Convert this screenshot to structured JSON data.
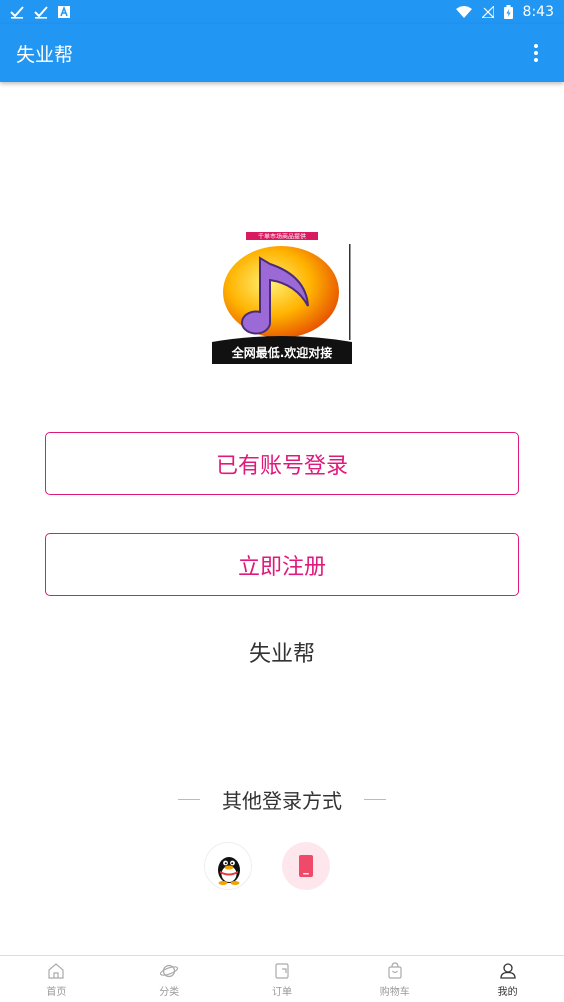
{
  "status_bar": {
    "time": "8:43"
  },
  "app_bar": {
    "title": "失业帮"
  },
  "logo": {
    "top_text": "千单市场商品提供",
    "bottom_text": "全网最低.欢迎对接"
  },
  "buttons": {
    "login": "已有账号登录",
    "register": "立即注册"
  },
  "app_name": "失业帮",
  "other_login": {
    "title": "其他登录方式"
  },
  "bottom_nav": {
    "items": [
      {
        "label": "首页",
        "icon": "home-icon"
      },
      {
        "label": "分类",
        "icon": "planet-icon"
      },
      {
        "label": "订单",
        "icon": "order-icon"
      },
      {
        "label": "购物车",
        "icon": "cart-icon"
      },
      {
        "label": "我的",
        "icon": "user-icon",
        "active": true
      }
    ]
  },
  "colors": {
    "primary": "#2196f3",
    "accent": "#e0197d"
  }
}
